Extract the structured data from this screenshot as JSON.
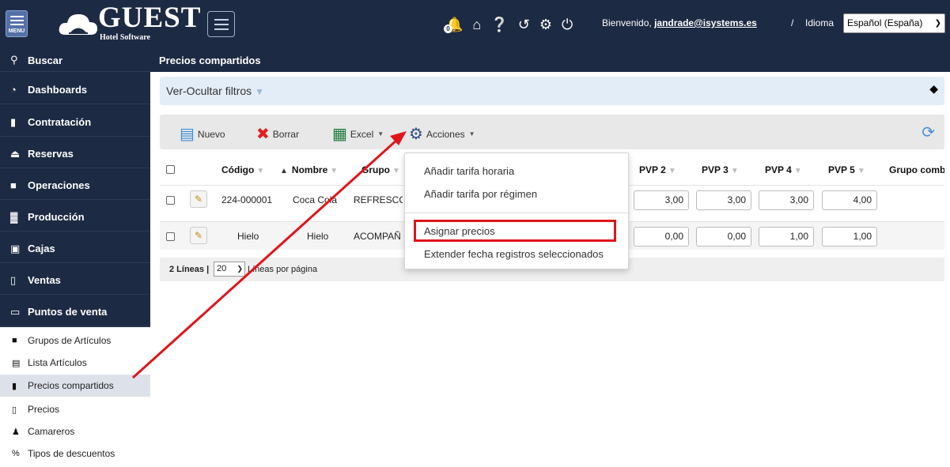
{
  "header": {
    "menu_label": "MENU",
    "logo_title": "GUEST",
    "logo_subtitle": "Hotel Software",
    "notification_count": "0",
    "welcome_text": "Bienvenido,",
    "user_email": "jandrade@isystems.es",
    "separator": "/",
    "language_label": "Idioma",
    "language_value": "Español (España)"
  },
  "sidebar": {
    "items": [
      {
        "label": "Buscar",
        "icon": "search-icon"
      },
      {
        "label": "Dashboards",
        "icon": "pie-chart-icon"
      },
      {
        "label": "Contratación",
        "icon": "document-icon"
      },
      {
        "label": "Reservas",
        "icon": "eject-icon"
      },
      {
        "label": "Operaciones",
        "icon": "clipboard-icon"
      },
      {
        "label": "Producción",
        "icon": "bar-chart-icon"
      },
      {
        "label": "Cajas",
        "icon": "cash-icon"
      },
      {
        "label": "Ventas",
        "icon": "receipt-icon"
      },
      {
        "label": "Puntos de venta",
        "icon": "monitor-icon"
      }
    ],
    "subitems": [
      {
        "label": "Grupos de Artículos",
        "icon": "folder-icon"
      },
      {
        "label": "Lista Artículos",
        "icon": "list-icon"
      },
      {
        "label": "Precios compartidos",
        "icon": "document-icon"
      },
      {
        "label": "Precios",
        "icon": "price-file-icon"
      },
      {
        "label": "Camareros",
        "icon": "person-icon"
      },
      {
        "label": "Tipos de descuentos",
        "icon": "percent-icon"
      }
    ]
  },
  "page": {
    "title": "Precios compartidos",
    "filters_label": "Ver-Ocultar filtros"
  },
  "toolbar": {
    "new_label": "Nuevo",
    "delete_label": "Borrar",
    "excel_label": "Excel",
    "actions_label": "Acciones"
  },
  "table": {
    "columns": [
      "Código",
      "Nombre",
      "Grupo",
      "PVP 2",
      "PVP 3",
      "PVP 4",
      "PVP 5",
      "Grupo comb"
    ],
    "rows": [
      {
        "codigo": "224-000001",
        "nombre": "Coca Cola",
        "grupo": "REFRESCO",
        "pvp2": "3,00",
        "pvp3": "3,00",
        "pvp4": "3,00",
        "pvp5": "4,00"
      },
      {
        "codigo": "Hielo",
        "nombre": "Hielo",
        "grupo": "ACOMPAÑ",
        "pvp2": "0,00",
        "pvp3": "0,00",
        "pvp4": "1,00",
        "pvp5": "1,00"
      }
    ],
    "pager": {
      "count_text": "2 Líneas |",
      "page_size": "20",
      "per_page_text": "Líneas por página"
    }
  },
  "actions_menu": {
    "items": [
      "Añadir tarifa horaria",
      "Añadir tarifa por régimen",
      "Asignar precios",
      "Extender fecha registros seleccionados"
    ]
  },
  "colors": {
    "header_bg": "#1d2a43",
    "highlight": "#e0151b",
    "filters_bg": "#e3edf8"
  }
}
